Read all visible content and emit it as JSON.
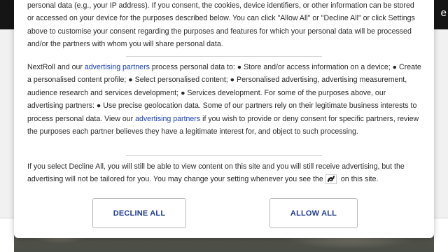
{
  "background": {
    "topbar_right_text": "e"
  },
  "consent": {
    "paragraph1": "personal data (e.g., your IP address). If you consent, the cookies, device identifiers, or other information can be stored or accessed on your device for the purposes described below. You can click \"Allow All\" or \"Decline All\" or click Settings above to customise your consent regarding the purposes and features for which your personal data will be processed and/or the partners with whom you will share personal data.",
    "paragraph2": {
      "part1": "NextRoll and our ",
      "link1": "advertising partners",
      "part2": " process personal data to: ● Store and/or access information on a device; ● Create a personalised content profile; ● Select personalised content; ● Personalised advertising, advertising measurement, audience research and services development; ● Services development. For some of the purposes above, our advertising partners: ● Use precise geolocation data. Some of our partners rely on their legitimate business interests to process personal data. View our ",
      "link2": "advertising partners",
      "part3": " if you wish to provide or deny consent for specific partners, review the purposes each partner believes they have a legitimate interest for, and object to such processing."
    },
    "paragraph3": {
      "part1": "If you select Decline All, you will still be able to view content on this site and you will still receive advertising, but the advertising will not be tailored for you. You may change your setting whenever you see the",
      "icon": "consent-settings-icon",
      "part2": "on this site."
    },
    "decline_label": "DECLINE ALL",
    "allow_label": "ALLOW ALL",
    "colors": {
      "link": "#1a3fb0",
      "button_text": "#1d3b8c",
      "topbar": "#151515"
    }
  }
}
